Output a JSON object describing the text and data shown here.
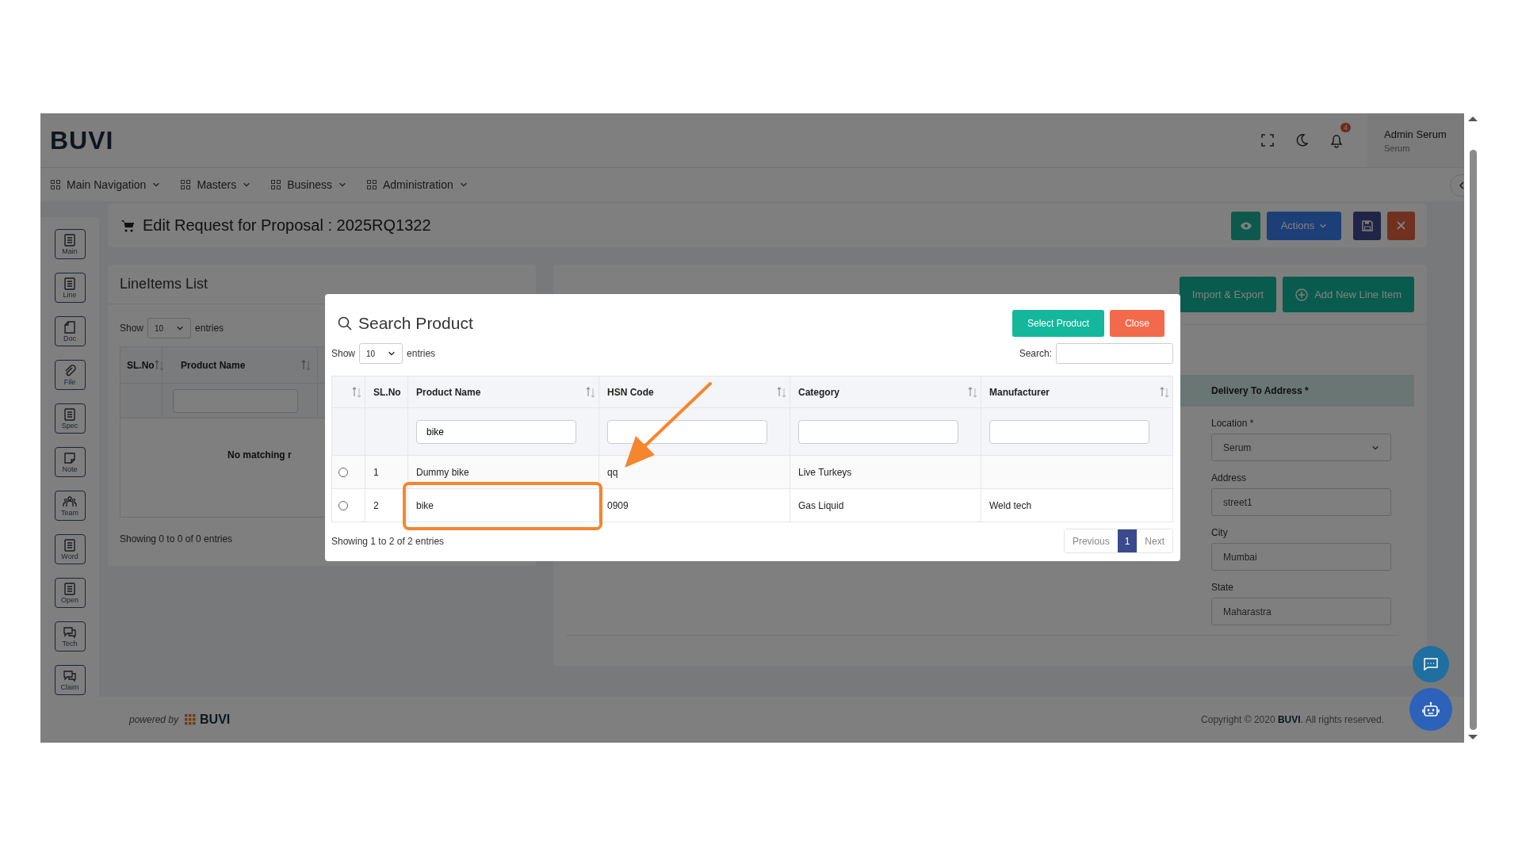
{
  "header": {
    "logo": "BUVI",
    "notification_count": "4",
    "user": {
      "name": "Admin Serum",
      "role": "Serum"
    }
  },
  "nav": [
    {
      "label": "Main Navigation"
    },
    {
      "label": "Masters"
    },
    {
      "label": "Business"
    },
    {
      "label": "Administration"
    }
  ],
  "sidebar": [
    {
      "label": "Main",
      "kind": "list"
    },
    {
      "label": "Line",
      "kind": "list"
    },
    {
      "label": "Doc",
      "kind": "page"
    },
    {
      "label": "File",
      "kind": "clip"
    },
    {
      "label": "Spec",
      "kind": "list"
    },
    {
      "label": "Note",
      "kind": "note"
    },
    {
      "label": "Team",
      "kind": "team"
    },
    {
      "label": "Word",
      "kind": "list"
    },
    {
      "label": "Open",
      "kind": "list"
    },
    {
      "label": "Tech",
      "kind": "chat"
    },
    {
      "label": "Claim",
      "kind": "chat"
    }
  ],
  "page_title": "Edit Request for Proposal : 2025RQ1322",
  "toolbar": {
    "actions_label": "Actions"
  },
  "lineitems_list": {
    "title": "LineItems List",
    "show_label": "Show",
    "page_size": "10",
    "entries_label": "entries",
    "columns": [
      {
        "label": "SL.No",
        "sortable": true
      },
      {
        "label": "Product Name",
        "sortable": true
      }
    ],
    "empty_message": "No matching r",
    "info": "Showing 0 to 0 of 0 entries"
  },
  "details": {
    "buttons": [
      {
        "label": "Import & Export",
        "kind": "plain"
      },
      {
        "label": "Add New Line Item",
        "kind": "add"
      }
    ],
    "section_title": "Delivery To Address *",
    "fields": [
      {
        "label": "Location *",
        "value": "Serum",
        "kind": "select"
      },
      {
        "label": "Address",
        "value": "street1",
        "kind": "text"
      },
      {
        "label": "City",
        "value": "Mumbai",
        "kind": "text"
      },
      {
        "label": "State",
        "value": "Maharastra",
        "kind": "text"
      }
    ]
  },
  "modal": {
    "title": "Search Product",
    "buttons": [
      {
        "label": "Select Product",
        "kind": "primary"
      },
      {
        "label": "Close",
        "kind": "danger"
      }
    ],
    "show_label": "Show",
    "page_size": "10",
    "entries_label": "entries",
    "search_label": "Search:",
    "select_column": {
      "sortable": true
    },
    "columns": [
      {
        "label": "SL.No",
        "sortable": false
      },
      {
        "label": "Product Name",
        "sortable": true,
        "filter": "bike"
      },
      {
        "label": "HSN Code",
        "sortable": true
      },
      {
        "label": "Category",
        "sortable": true
      },
      {
        "label": "Manufacturer",
        "sortable": true
      }
    ],
    "rows": [
      {
        "selected": false,
        "cells": [
          "1",
          "Dummy bike",
          "qq",
          "Live Turkeys"
        ]
      },
      {
        "selected": false,
        "cells": [
          "2",
          "bike",
          "0909",
          "Gas Liquid",
          "Weld tech"
        ]
      }
    ],
    "info": "Showing 1 to 2 of 2 entries",
    "pagination": {
      "previous": "Previous",
      "pages": [
        {
          "label": "1",
          "selected": true
        }
      ],
      "next": "Next"
    }
  },
  "footer": {
    "powered_by": "powered by",
    "brand": "BUVI",
    "copyright": "Copyright © 2020 **BUVI**. All rights reserved."
  }
}
